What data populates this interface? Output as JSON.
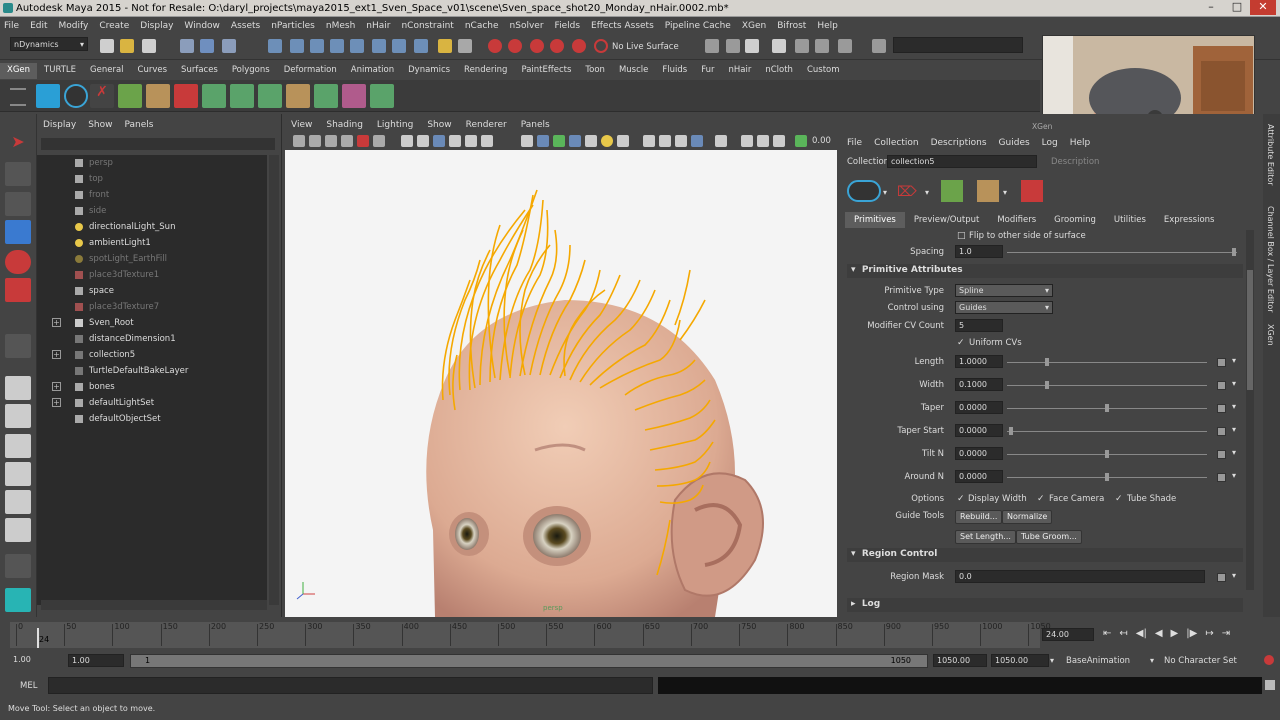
{
  "title_bar": {
    "title": "Autodesk Maya 2015 - Not for Resale: O:\\daryl_projects\\maya2015_ext1_Sven_Space_v01\\scene\\Sven_space_shot20_Monday_nHair.0002.mb*"
  },
  "menu": [
    "File",
    "Edit",
    "Modify",
    "Create",
    "Display",
    "Window",
    "Assets",
    "nParticles",
    "nMesh",
    "nHair",
    "nConstraint",
    "nCache",
    "nSolver",
    "Fields",
    "Effects Assets",
    "Pipeline Cache",
    "XGen",
    "Bifrost",
    "Help"
  ],
  "status_line": {
    "menu_set": "nDynamics",
    "live_surface": "No Live Surface"
  },
  "shelf_tabs": [
    "XGen",
    "TURTLE",
    "General",
    "Curves",
    "Surfaces",
    "Polygons",
    "Deformation",
    "Animation",
    "Dynamics",
    "Rendering",
    "PaintEffects",
    "Toon",
    "Muscle",
    "Fluids",
    "Fur",
    "nHair",
    "nCloth",
    "Custom"
  ],
  "shelf_active": "XGen",
  "outliner": {
    "menu": [
      "Display",
      "Show",
      "Panels"
    ],
    "items": [
      {
        "label": "persp",
        "dim": true,
        "expand": false
      },
      {
        "label": "top",
        "dim": true,
        "expand": false
      },
      {
        "label": "front",
        "dim": true,
        "expand": false
      },
      {
        "label": "side",
        "dim": true,
        "expand": false
      },
      {
        "label": "directionalLight_Sun",
        "dim": false,
        "expand": false
      },
      {
        "label": "ambientLight1",
        "dim": false,
        "expand": false
      },
      {
        "label": "spotLight_EarthFill",
        "dim": true,
        "expand": false
      },
      {
        "label": "place3dTexture1",
        "dim": true,
        "expand": false
      },
      {
        "label": "space",
        "dim": false,
        "expand": false
      },
      {
        "label": "place3dTexture7",
        "dim": true,
        "expand": false
      },
      {
        "label": "Sven_Root",
        "dim": false,
        "expand": true
      },
      {
        "label": "distanceDimension1",
        "dim": false,
        "expand": false
      },
      {
        "label": "collection5",
        "dim": false,
        "expand": true
      },
      {
        "label": "TurtleDefaultBakeLayer",
        "dim": false,
        "expand": false
      },
      {
        "label": "bones",
        "dim": false,
        "expand": true
      },
      {
        "label": "defaultLightSet",
        "dim": false,
        "expand": true
      },
      {
        "label": "defaultObjectSet",
        "dim": false,
        "expand": false
      }
    ]
  },
  "viewport": {
    "menu": [
      "View",
      "Shading",
      "Lighting",
      "Show",
      "Renderer",
      "Panels"
    ],
    "value": "0.00",
    "camera_label": "persp"
  },
  "xgen": {
    "header": "XGen",
    "menu": [
      "File",
      "Collection",
      "Descriptions",
      "Guides",
      "Log",
      "Help"
    ],
    "collection_label": "Collection",
    "collection_value": "collection5",
    "description_label": "Description",
    "tabs": [
      "Primitives",
      "Preview/Output",
      "Modifiers",
      "Grooming",
      "Utilities",
      "Expressions"
    ],
    "active_tab": "Primitives",
    "flip_label": "Flip to other side of surface",
    "spacing": {
      "label": "Spacing",
      "value": "1.0"
    },
    "section_primitive": "Primitive Attributes",
    "primitive_type": {
      "label": "Primitive Type",
      "value": "Spline"
    },
    "control_using": {
      "label": "Control using",
      "value": "Guides"
    },
    "modifier_cv": {
      "label": "Modifier CV Count",
      "value": "5"
    },
    "uniform_cvs": "Uniform CVs",
    "sliders": [
      {
        "label": "Length",
        "value": "1.0000",
        "pos": 0.2
      },
      {
        "label": "Width",
        "value": "0.1000",
        "pos": 0.2
      },
      {
        "label": "Taper",
        "value": "0.0000",
        "pos": 0.6
      },
      {
        "label": "Taper Start",
        "value": "0.0000",
        "pos": 0.0
      },
      {
        "label": "Tilt N",
        "value": "0.0000",
        "pos": 0.6
      },
      {
        "label": "Around N",
        "value": "0.0000",
        "pos": 0.6
      }
    ],
    "options_label": "Options",
    "options": [
      "Display Width",
      "Face Camera",
      "Tube Shade"
    ],
    "guide_tools_label": "Guide Tools",
    "guide_buttons": [
      "Rebuild...",
      "Normalize",
      "Set Length...",
      "Tube Groom..."
    ],
    "section_region": "Region Control",
    "region_mask": {
      "label": "Region Mask",
      "value": "0.0"
    },
    "section_log": "Log",
    "side_tabs": [
      "Attribute Editor",
      "Channel Box / Layer Editor",
      "XGen"
    ]
  },
  "timeline": {
    "ticks": [
      "0",
      "50",
      "100",
      "150",
      "200",
      "250",
      "300",
      "350",
      "400",
      "450",
      "500",
      "550",
      "600",
      "650",
      "700",
      "750",
      "800",
      "850",
      "900",
      "950",
      "1000",
      "1050"
    ],
    "current_frame_marker": "24",
    "current_frame": "24.00"
  },
  "range": {
    "start": "1.00",
    "start2": "1.00",
    "range_start": "1",
    "range_end": "1050",
    "end": "1050.00",
    "end2": "1050.00",
    "anim_layer": "BaseAnimation",
    "char_set": "No Character Set"
  },
  "command_line": {
    "label": "MEL"
  },
  "help_line": {
    "text": "Move Tool: Select an object to move."
  },
  "colors": {
    "hair": "#f5a800",
    "accent": "#5d5d5d"
  }
}
